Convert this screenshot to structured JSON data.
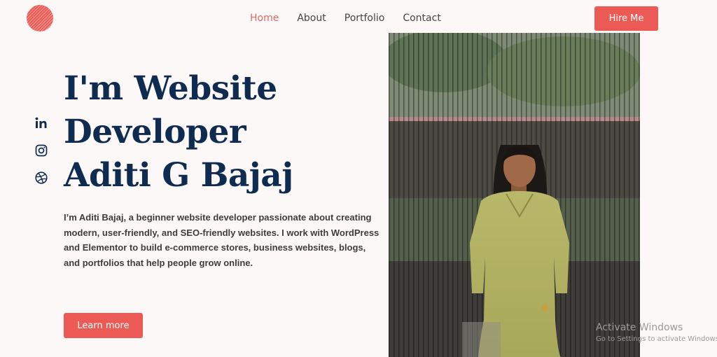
{
  "nav": {
    "items": [
      {
        "label": "Home",
        "active": true
      },
      {
        "label": "About",
        "active": false
      },
      {
        "label": "Portfolio",
        "active": false
      },
      {
        "label": "Contact",
        "active": false
      }
    ],
    "hire_label": "Hire Me"
  },
  "hero": {
    "title_lines": [
      "I'm Website",
      "Developer",
      "Aditi G Bajaj"
    ],
    "description": "I’m Aditi Bajaj, a beginner website developer passionate about creating modern, user-friendly, and SEO-friendly websites. I work with WordPress and Elementor to build e-commerce stores, business websites, blogs, and portfolios that help people grow online.",
    "cta_label": "Learn more"
  },
  "socials": [
    "linkedin-icon",
    "instagram-icon",
    "dribbble-icon"
  ],
  "colors": {
    "accent": "#ec5a56",
    "heading": "#0f2b50",
    "background": "#fcf8f8",
    "active_nav": "#e06b60"
  },
  "watermark": {
    "title": "Activate Windows",
    "subtitle": "Go to Settings to activate Windows."
  }
}
